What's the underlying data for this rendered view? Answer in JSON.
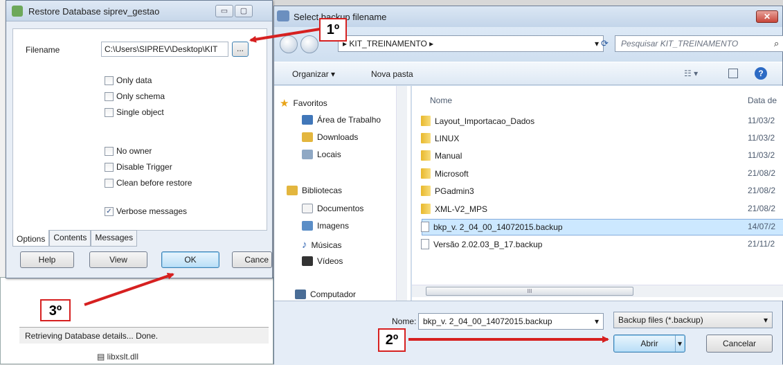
{
  "background": {
    "status": "Retrieving Database details... Done.",
    "dll_item": "libxslt.dll"
  },
  "restore": {
    "title": "Restore Database siprev_gestao",
    "filename_label": "Filename",
    "filename_value": "C:\\Users\\SIPREV\\Desktop\\KIT",
    "browse": "...",
    "checkboxes": [
      {
        "label": "Only data",
        "checked": false
      },
      {
        "label": "Only schema",
        "checked": false
      },
      {
        "label": "Single object",
        "checked": false
      },
      {
        "label": "No owner",
        "checked": false
      },
      {
        "label": "Disable Trigger",
        "checked": false
      },
      {
        "label": "Clean before restore",
        "checked": false
      },
      {
        "label": "Verbose messages",
        "checked": true
      }
    ],
    "tabs": [
      "Options",
      "Contents",
      "Messages"
    ],
    "buttons": {
      "help": "Help",
      "view": "View",
      "ok": "OK",
      "cancel": "Cance"
    }
  },
  "filedlg": {
    "title": "Select backup filename",
    "path": "KIT_TREINAMENTO",
    "search_placeholder": "Pesquisar KIT_TREINAMENTO",
    "toolbar": {
      "organize": "Organizar ▾",
      "new_folder": "Nova pasta"
    },
    "nav": [
      {
        "label": "Favoritos",
        "icon": "star-icon"
      },
      {
        "label": "Área de Trabalho",
        "icon": "desktop-icon"
      },
      {
        "label": "Downloads",
        "icon": "downloads-icon"
      },
      {
        "label": "Locais",
        "icon": "places-icon"
      },
      {
        "label": "Bibliotecas",
        "icon": "library-icon"
      },
      {
        "label": "Documentos",
        "icon": "documents-icon"
      },
      {
        "label": "Imagens",
        "icon": "images-icon"
      },
      {
        "label": "Músicas",
        "icon": "music-icon"
      },
      {
        "label": "Vídeos",
        "icon": "videos-icon"
      },
      {
        "label": "Computador",
        "icon": "computer-icon"
      }
    ],
    "columns": {
      "name": "Nome",
      "date": "Data de"
    },
    "files": [
      {
        "name": "Layout_Importacao_Dados",
        "date": "11/03/2",
        "type": "folder"
      },
      {
        "name": "LINUX",
        "date": "11/03/2",
        "type": "folder"
      },
      {
        "name": "Manual",
        "date": "11/03/2",
        "type": "folder"
      },
      {
        "name": "Microsoft",
        "date": "21/08/2",
        "type": "folder"
      },
      {
        "name": "PGadmin3",
        "date": "21/08/2",
        "type": "folder"
      },
      {
        "name": "XML-V2_MPS",
        "date": "21/08/2",
        "type": "folder"
      },
      {
        "name": "bkp_v. 2_04_00_14072015.backup",
        "date": "14/07/2",
        "type": "file",
        "selected": true
      },
      {
        "name": "Versão 2.02.03_B_17.backup",
        "date": "21/11/2",
        "type": "file"
      }
    ],
    "scroll_mark": "III",
    "filename_label": "Nome:",
    "filename_value": "bkp_v. 2_04_00_14072015.backup",
    "filter": "Backup files (*.backup)",
    "open": "Abrir",
    "cancel": "Cancelar"
  },
  "annotations": {
    "step1": "1º",
    "step2": "2º",
    "step3": "3º"
  },
  "colors": {
    "arrow": "#d62020",
    "selection": "#cce8ff"
  }
}
